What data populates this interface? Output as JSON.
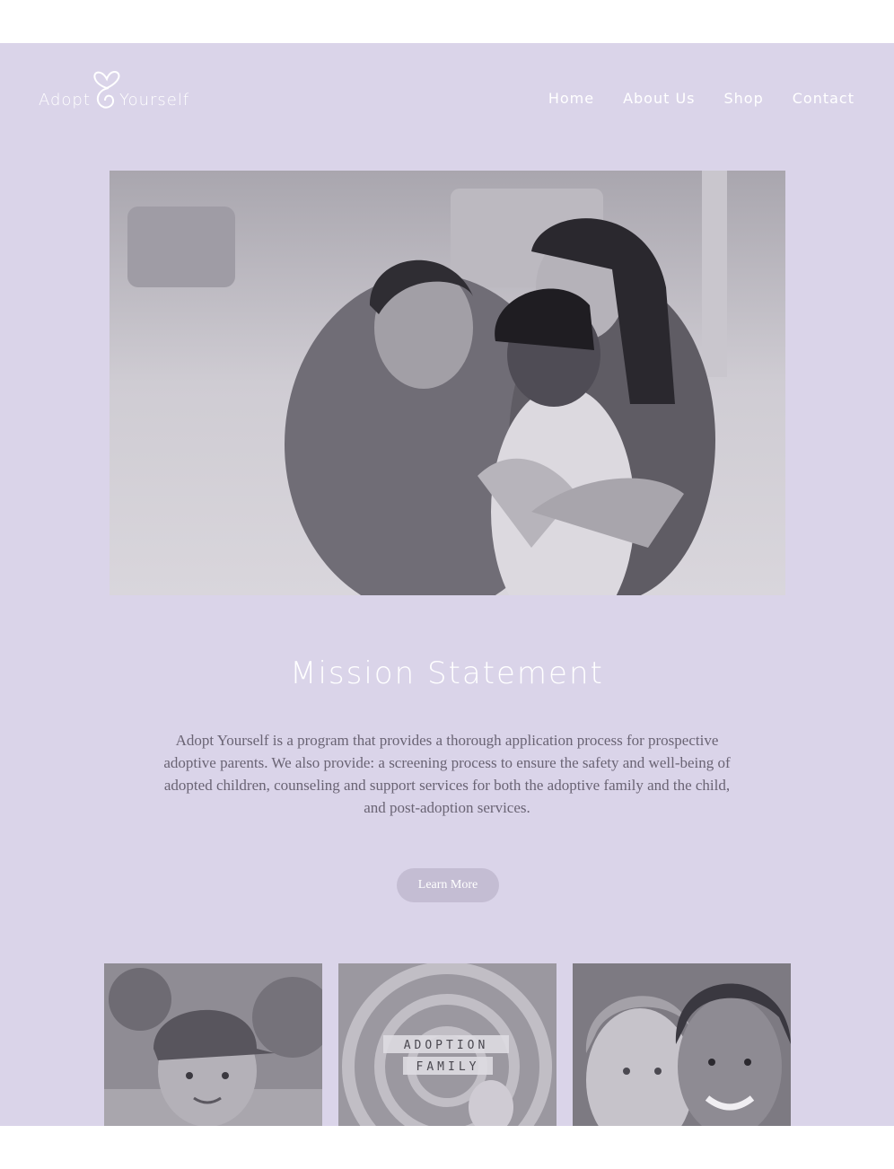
{
  "header": {
    "logo": {
      "word_left": "Adopt",
      "word_right": "Yourself"
    },
    "nav": [
      "Home",
      "About Us",
      "Shop",
      "Contact"
    ]
  },
  "hero": {
    "icon": "family-photo"
  },
  "mission": {
    "title": "Mission Statement",
    "body": "Adopt Yourself is a program that provides a thorough application process for prospective adoptive parents. We also provide: a screening process to ensure the safety and well-being of adopted children, counseling and support services for both the adoptive family and the child, and post-adoption services.",
    "button_label": "Learn More"
  },
  "gallery": {
    "tiles": [
      {
        "icon": "boy-photo"
      },
      {
        "icon": "scrabble-tiles-photo",
        "word1": "ADOPTION",
        "word2": "FAMILY"
      },
      {
        "icon": "mother-daughter-photo"
      }
    ]
  },
  "colors": {
    "panel_bg": "#dad4e9",
    "button_bg": "#c4bdd3",
    "body_text": "#6a6474"
  }
}
